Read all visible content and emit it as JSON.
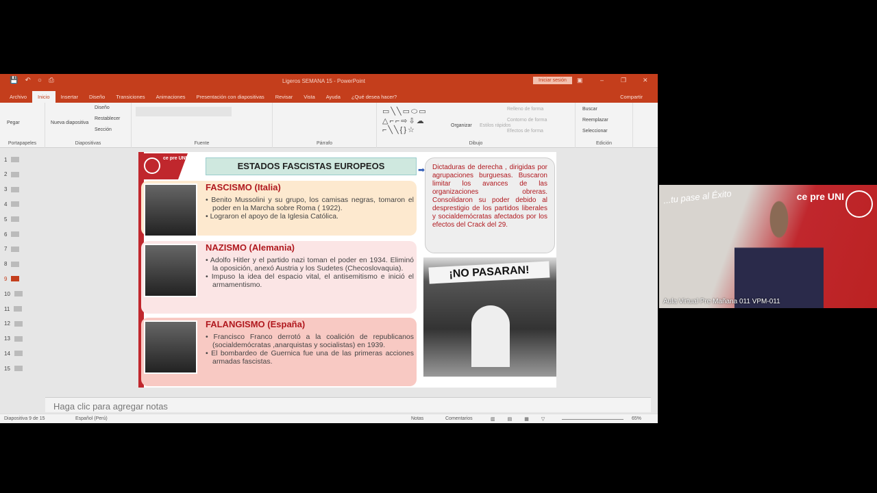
{
  "window": {
    "title": "Ligeros SEMANA 15 - PowerPoint",
    "signin": "Iniciar sesión",
    "share": "Compartir"
  },
  "tabs": [
    "Archivo",
    "Inicio",
    "Insertar",
    "Diseño",
    "Transiciones",
    "Animaciones",
    "Presentación con diapositivas",
    "Revisar",
    "Vista",
    "Ayuda",
    "¿Qué desea hacer?"
  ],
  "ribbon": {
    "paste": "Pegar",
    "clipboard": "Portapapeles",
    "new_slide": "Nueva diapositiva",
    "layout": "Diseño",
    "reset": "Restablecer",
    "section": "Sección",
    "slides": "Diapositivas",
    "font": "Fuente",
    "paragraph": "Párrafo",
    "arrange": "Organizar",
    "quick_styles": "Estilos rápidos",
    "fill": "Relleno de forma",
    "outline": "Contorno de forma",
    "effects": "Efectos de forma",
    "drawing": "Dibujo",
    "find": "Buscar",
    "replace": "Reemplazar",
    "select": "Seleccionar",
    "editing": "Edición"
  },
  "thumbnails": [
    "1",
    "2",
    "3",
    "4",
    "5",
    "6",
    "7",
    "8",
    "9",
    "10",
    "11",
    "12",
    "13",
    "14",
    "15"
  ],
  "slide": {
    "logo": "ce pre UNI",
    "title": "ESTADOS FASCISTAS EUROPEOS",
    "sections": [
      {
        "heading": "FASCISMO (Italia)",
        "bullets": [
          "Benito Mussolini y su grupo, los camisas negras, tomaron el poder en la Marcha sobre Roma ( 1922).",
          "Lograron el apoyo de la Iglesia Católica."
        ]
      },
      {
        "heading": "NAZISMO (Alemania)",
        "bullets": [
          "Adolfo Hitler y el partido nazi toman el poder en 1934. Eliminó la oposición, anexó Austria y los Sudetes (Checoslovaquia).",
          "Impuso la idea del espacio vital, el antisemitismo e inició el armamentismo."
        ]
      },
      {
        "heading": "FALANGISMO (España)",
        "bullets": [
          "Francisco Franco derrotó a la coalición de republicanos (socialdemócratas ,anarquistas y socialistas) en 1939.",
          "El bombardeo de Guernica fue una de las primeras acciones armadas fascistas."
        ]
      }
    ],
    "note": "Dictaduras de derecha , dirigidas por agrupaciones burguesas. Buscaron limitar los avances de las organizaciones obreras. Consolidaron su poder debido al desprestigio de los partidos liberales y socialdemócratas afectados por los efectos del Crack del 29.",
    "banner": "¡NO PASARAN!"
  },
  "notes_placeholder": "Haga clic para agregar notas",
  "status": {
    "slide": "Diapositiva 9 de 15",
    "language": "Español (Perú)",
    "notes": "Notas",
    "comments": "Comentarios",
    "zoom": "65%"
  },
  "webcam": {
    "slogan": "...tu pase al Éxito",
    "brand": "ce pre UNI",
    "name": "Aula Virtual Pre Mañana 011 VPM-011"
  }
}
